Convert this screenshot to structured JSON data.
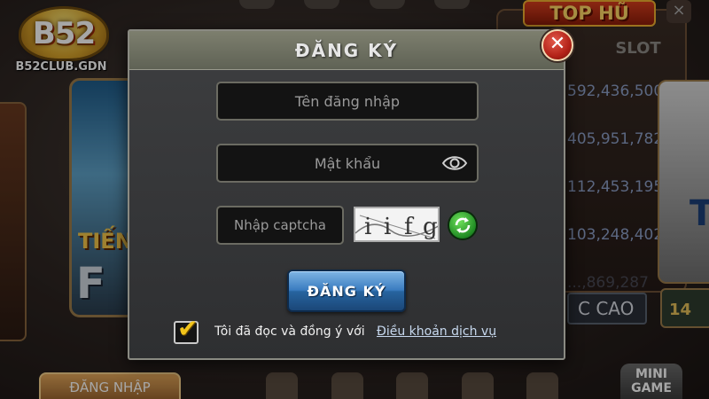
{
  "brand": {
    "logo_text": "B52",
    "domain": "B52CLUB.GDN"
  },
  "background": {
    "top_hu_title": "TOP HŨ",
    "top_hu_close": "×",
    "slot_tab": "SLOT",
    "jackpots": [
      "592,436,500",
      "405,951,782",
      "112,453,195",
      "103,248,402",
      "...,869,287"
    ],
    "game_tile_text": "TIẾN",
    "game_tile_letter": "F",
    "cao_badge": "C CAO",
    "right_mini_text": "14",
    "bottom_button": "ĐĂNG NHẬP",
    "mini_game": "MINI GAME",
    "right_card_text": "Tổ"
  },
  "dialog": {
    "title": "ĐĂNG KÝ",
    "close_label": "✕",
    "username": {
      "value": "",
      "placeholder": "Tên đăng nhập"
    },
    "password": {
      "value": "",
      "placeholder": "Mật khẩu"
    },
    "captcha": {
      "value": "",
      "placeholder": "Nhập captcha",
      "image_text": [
        "i",
        "i",
        "f",
        "g"
      ]
    },
    "submit_label": "ĐĂNG KÝ",
    "agree": {
      "checked": true,
      "text": "Tôi đã đọc và đồng ý với",
      "link_text": "Điều khoản dịch vụ"
    }
  },
  "icons": {
    "eye": "eye-icon",
    "refresh": "refresh-icon",
    "check": "checkmark-icon",
    "close": "close-icon",
    "plane": "plane-icon"
  },
  "colors": {
    "register_button": "#3a7cc0",
    "close_button": "#b32218",
    "refresh_button": "#1f8a23",
    "checkmark": "#f2c41a",
    "jackpot_text": "#8c9fc6"
  }
}
